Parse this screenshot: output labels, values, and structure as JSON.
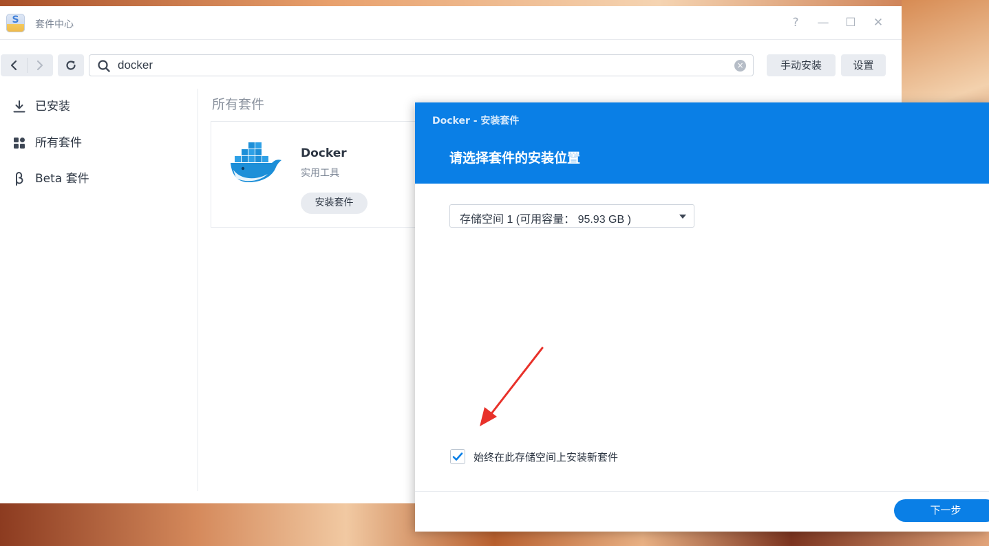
{
  "window": {
    "title": "套件中心",
    "app_icon_letter": "S",
    "help_icon": "?",
    "minimize_icon": "—",
    "maximize_icon": "☐",
    "close_icon": "✕"
  },
  "toolbar": {
    "search_value": "docker",
    "clear_icon": "×",
    "manual_install_label": "手动安装",
    "settings_label": "设置"
  },
  "sidebar": {
    "items": [
      {
        "label": "已安装",
        "icon": "download-icon"
      },
      {
        "label": "所有套件",
        "icon": "grid-icon"
      },
      {
        "label": "Beta 套件",
        "icon": "beta-icon"
      }
    ]
  },
  "content": {
    "section_title": "所有套件",
    "package": {
      "name": "Docker",
      "category": "实用工具",
      "install_label": "安装套件",
      "logo": "docker-whale-icon"
    }
  },
  "dialog": {
    "app_title": "Docker - 安装套件",
    "title": "请选择套件的安装位置",
    "volume_selected": "存储空间 1 (可用容量： 95.93 GB )",
    "always_install_label": "始终在此存储空间上安装新套件",
    "always_install_checked": true,
    "next_label": "下一步"
  },
  "colors": {
    "accent": "#0a7fe6",
    "annotation_arrow": "#e8312a"
  }
}
